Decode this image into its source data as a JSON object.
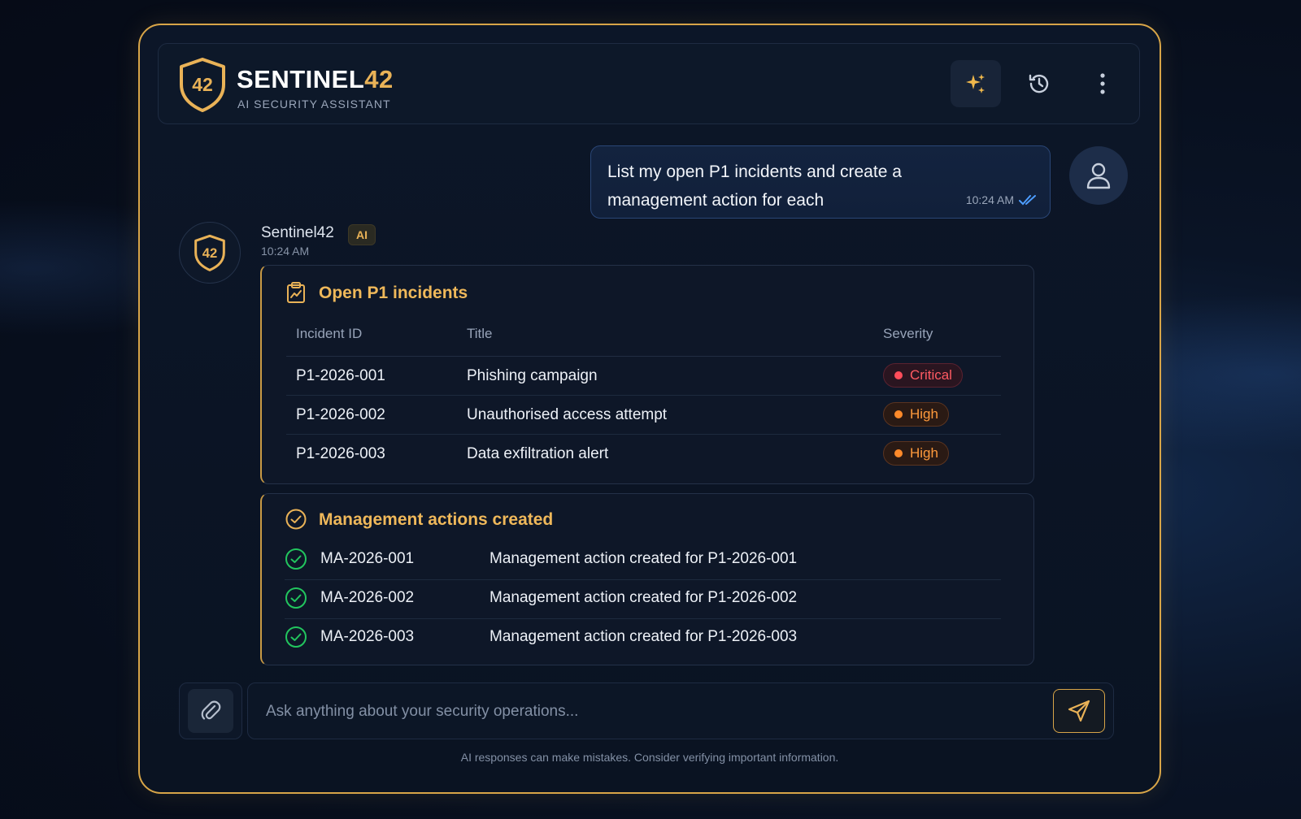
{
  "header": {
    "brand_main": "SENTINEL",
    "brand_accent": "42",
    "subtitle": "AI SECURITY ASSISTANT",
    "logo_text": "42",
    "icons": [
      "sparkle-icon",
      "history-icon",
      "more-vertical-icon"
    ]
  },
  "user_message": {
    "text": "List my open P1 incidents and create a management action for each",
    "time": "10:24 AM"
  },
  "assistant": {
    "name": "Sentinel42",
    "badge": "AI",
    "time": "10:24 AM",
    "avatar_text": "42"
  },
  "incidents_card": {
    "title": "Open P1 incidents",
    "columns": [
      "Incident ID",
      "Title",
      "Severity"
    ],
    "rows": [
      {
        "id": "P1-2026-001",
        "title": "Phishing campaign",
        "severity": "Critical"
      },
      {
        "id": "P1-2026-002",
        "title": "Unauthorised access attempt",
        "severity": "High"
      },
      {
        "id": "P1-2026-003",
        "title": "Data exfiltration alert",
        "severity": "High"
      }
    ]
  },
  "actions_card": {
    "title": "Management actions created",
    "rows": [
      {
        "id": "MA-2026-001",
        "desc": "Management action created for P1-2026-001"
      },
      {
        "id": "MA-2026-002",
        "desc": "Management action created for P1-2026-002"
      },
      {
        "id": "MA-2026-003",
        "desc": "Management action created for P1-2026-003"
      }
    ]
  },
  "composer": {
    "placeholder": "Ask anything about your security operations...",
    "value": ""
  },
  "disclaimer": "AI responses can make mistakes. Consider verifying important information.",
  "colors": {
    "accent": "#e9b257",
    "critical": "#ff5a62",
    "high": "#ff9a3c",
    "success": "#22c55e",
    "background": "#070e1c"
  }
}
